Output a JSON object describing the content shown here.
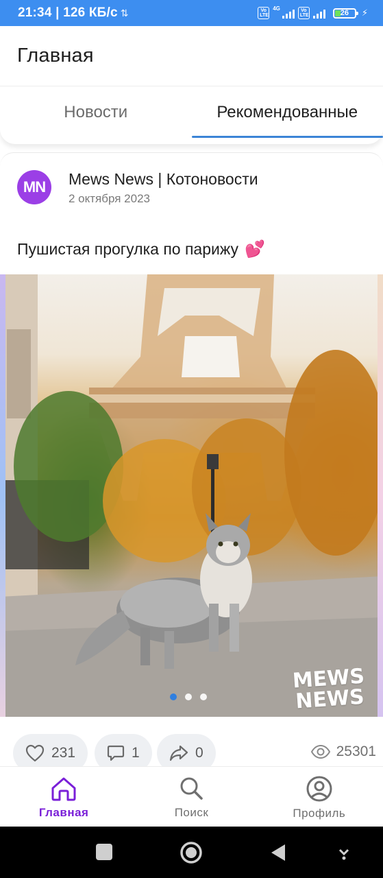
{
  "status_bar": {
    "time": "21:34 | 126 КБ/с",
    "network_1": "4G",
    "battery_level": "26",
    "battery_color": "#6ee05c"
  },
  "header": {
    "title": "Главная"
  },
  "tabs": [
    {
      "label": "Новости",
      "active": false
    },
    {
      "label": "Рекомендованные",
      "active": true
    }
  ],
  "post": {
    "avatar_initials": "MN",
    "avatar_color": "#9b3fe6",
    "author": "Mews News | Котоновости",
    "date": "2 октября 2023",
    "text": "Пушистая прогулка по парижу",
    "text_emoji": "💕",
    "image": {
      "description_icon": "cat-eiffel-photo",
      "watermark": "MEWS NEWS",
      "carousel_count": 3,
      "carousel_active": 1
    },
    "likes": "231",
    "comments": "1",
    "shares": "0",
    "views": "25301"
  },
  "bottom_nav": [
    {
      "label": "Главная",
      "icon": "home-icon",
      "active": true
    },
    {
      "label": "Поиск",
      "icon": "search-icon",
      "active": false
    },
    {
      "label": "Профиль",
      "icon": "profile-icon",
      "active": false
    }
  ],
  "colors": {
    "accent": "#7a1fd8",
    "tab_indicator": "#3b84d6",
    "status_bar": "#3d8ef0"
  }
}
